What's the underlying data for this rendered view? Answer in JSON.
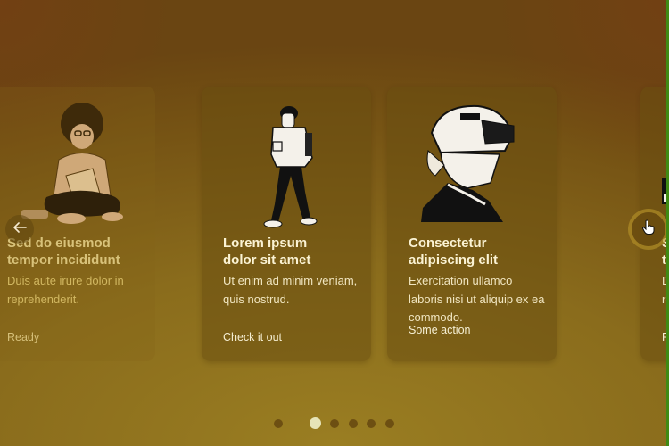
{
  "theme": {
    "background": "#8a6c1c",
    "card_background": "#6f5214",
    "title_color": "#fbf3d4",
    "dot_active": "#e6e4b8",
    "dot_inactive": "#6d4f12"
  },
  "carousel": {
    "prev_icon": "arrow-left-icon",
    "next_icon": "hand-pointer-cursor-icon",
    "cards": [
      {
        "illustration": "person-reading-book-illustration",
        "title_line1": "Sed do eiusmod",
        "title_line2": "tempor incididunt",
        "body": "Duis aute irure dolor in reprehenderit.",
        "action": "Ready"
      },
      {
        "illustration": "person-walking-with-phone-illustration",
        "title_line1": "Lorem ipsum",
        "title_line2": "dolor sit amet",
        "body": "Ut enim ad minim veniam, quis nostrud.",
        "action": "Check it out"
      },
      {
        "illustration": "person-with-helmet-illustration",
        "title_line1": "Consectetur",
        "title_line2": "adipiscing elit",
        "body": "Exercitation ullamco laboris nisi ut aliquip ex ea commodo.",
        "action": "Some action"
      },
      {
        "illustration": "person-reading-book-illustration",
        "title_line1": "Sed do eiusmod",
        "title_line2": "tempor incididunt",
        "body": "Duis aute irure dolor in reprehenderit.",
        "action": "Ready"
      }
    ],
    "pagination": {
      "total": 6,
      "active_index": 1
    }
  }
}
